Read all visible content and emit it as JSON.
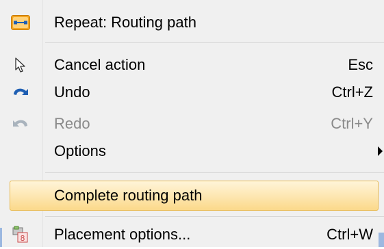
{
  "menu": {
    "items": [
      {
        "label": "Repeat: Routing path",
        "shortcut": "",
        "icon": "routing-path-icon",
        "disabled": false
      },
      {
        "label": "Cancel action",
        "shortcut": "Esc",
        "icon": "arrow-cursor-icon",
        "disabled": false
      },
      {
        "label": "Undo",
        "shortcut": "Ctrl+Z",
        "icon": "undo-icon",
        "disabled": false
      },
      {
        "label": "Redo",
        "shortcut": "Ctrl+Y",
        "icon": "redo-icon",
        "disabled": true
      },
      {
        "label": "Options",
        "shortcut": "",
        "icon": "",
        "disabled": false,
        "submenu": true
      },
      {
        "label": "Complete routing path",
        "shortcut": "",
        "icon": "",
        "disabled": false,
        "highlighted": true
      },
      {
        "label": "Placement options...",
        "shortcut": "Ctrl+W",
        "icon": "placement-options-icon",
        "disabled": false
      }
    ]
  },
  "colors": {
    "highlight_border": "#e9b94c",
    "highlight_top": "#fff4d8",
    "highlight_bottom": "#fbd98a",
    "icon_blue": "#1f5fb3",
    "disabled_text": "#8a8a8a"
  }
}
